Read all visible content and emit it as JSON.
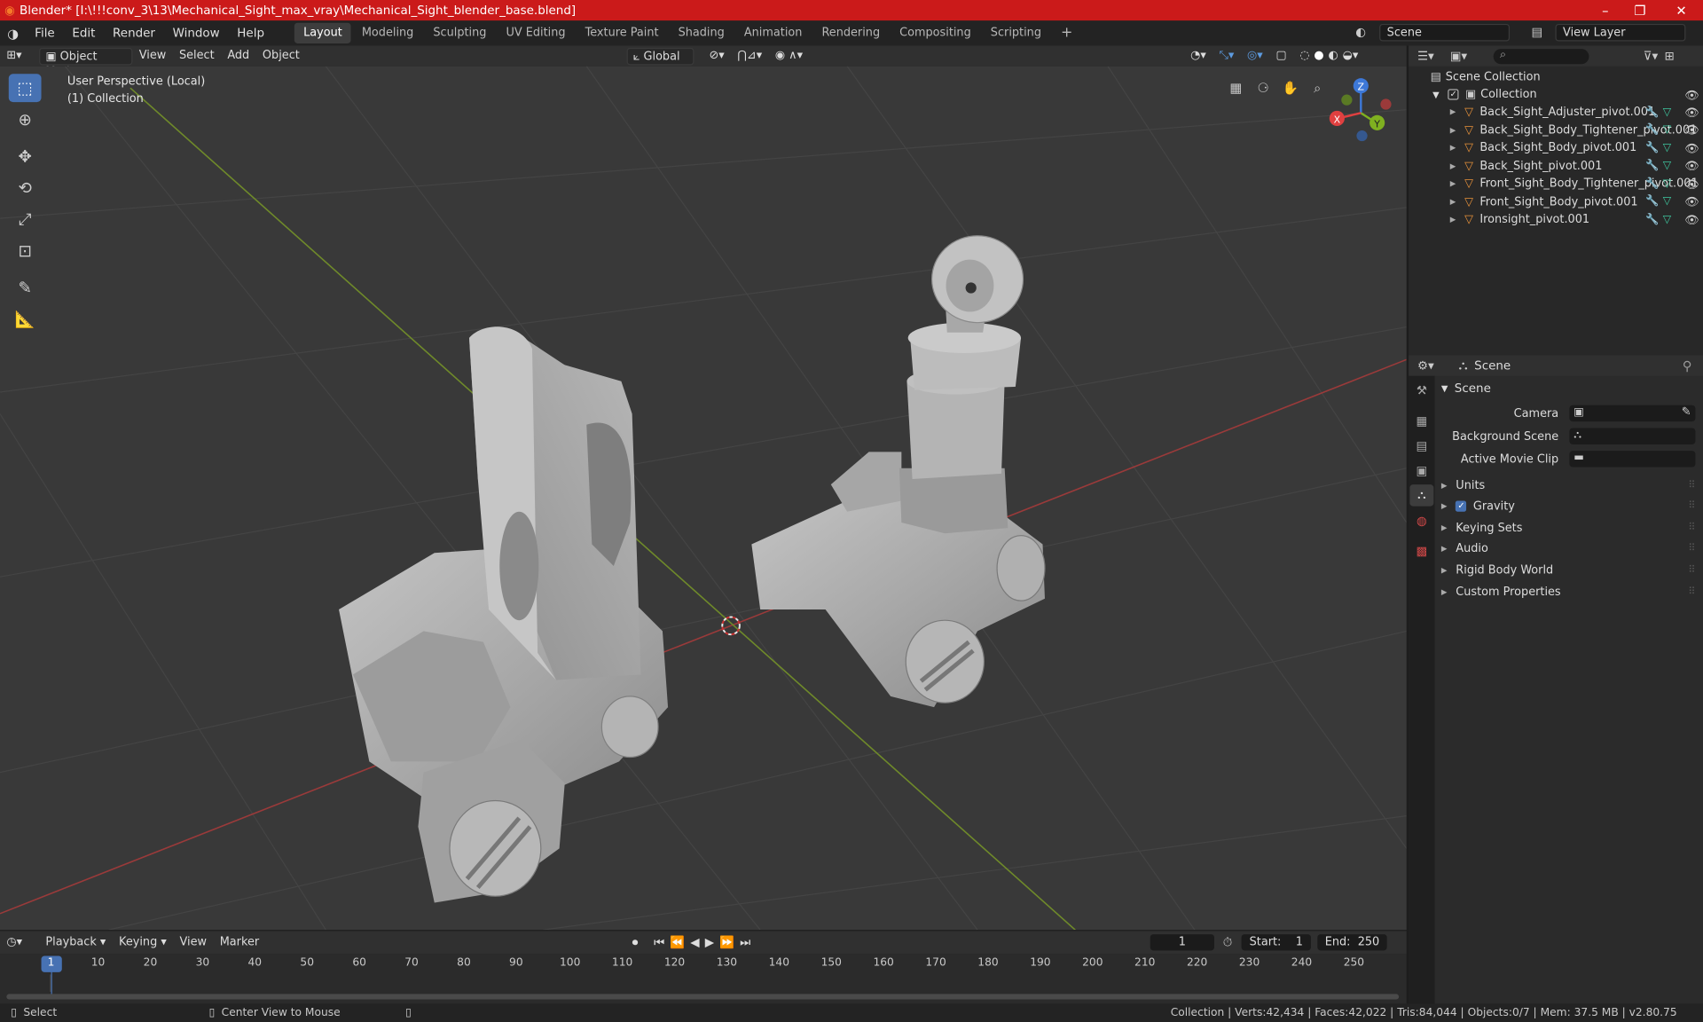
{
  "titlebar": {
    "title": "Blender* [I:\\!!!conv_3\\13\\Mechanical_Sight_max_vray\\Mechanical_Sight_blender_base.blend]"
  },
  "menu": [
    "File",
    "Edit",
    "Render",
    "Window",
    "Help"
  ],
  "workspaces": [
    "Layout",
    "Modeling",
    "Sculpting",
    "UV Editing",
    "Texture Paint",
    "Shading",
    "Animation",
    "Rendering",
    "Compositing",
    "Scripting"
  ],
  "scene": {
    "label": "Scene",
    "view_layer": "View Layer"
  },
  "viewport_header": {
    "mode": "Object Mode",
    "view": "View",
    "select": "Select",
    "add": "Add",
    "object": "Object",
    "orientation": "Global"
  },
  "viewport": {
    "perspective": "User Perspective (Local)",
    "collection": "(1) Collection"
  },
  "gizmo": {
    "x": "X",
    "y": "Y",
    "z": "Z"
  },
  "outliner": {
    "scene_collection": "Scene Collection",
    "collection": "Collection",
    "items": [
      "Back_Sight_Adjuster_pivot.001",
      "Back_Sight_Body_Tightener_pivot.001",
      "Back_Sight_Body_pivot.001",
      "Back_Sight_pivot.001",
      "Front_Sight_Body_Tightener_pivot.001",
      "Front_Sight_Body_pivot.001",
      "Ironsight_pivot.001"
    ]
  },
  "properties": {
    "context": "Scene",
    "panel": "Scene",
    "camera_label": "Camera",
    "bg_scene_label": "Background Scene",
    "movie_clip_label": "Active Movie Clip",
    "sections": [
      "Units",
      "Gravity",
      "Keying Sets",
      "Audio",
      "Rigid Body World",
      "Custom Properties"
    ]
  },
  "timeline": {
    "playback": "Playback",
    "keying": "Keying",
    "view": "View",
    "marker": "Marker",
    "current_frame": "1",
    "start_label": "Start:",
    "start": "1",
    "end_label": "End:",
    "end": "250",
    "ticks": [
      "1",
      "10",
      "20",
      "30",
      "40",
      "50",
      "60",
      "70",
      "80",
      "90",
      "100",
      "110",
      "120",
      "130",
      "140",
      "150",
      "160",
      "170",
      "180",
      "190",
      "200",
      "210",
      "220",
      "230",
      "240",
      "250"
    ]
  },
  "status": {
    "select": "Select",
    "center": "Center View to Mouse",
    "stats": "Collection | Verts:42,434 | Faces:42,022 | Tris:84,044 | Objects:0/7 | Mem: 37.5 MB | v2.80.75"
  }
}
